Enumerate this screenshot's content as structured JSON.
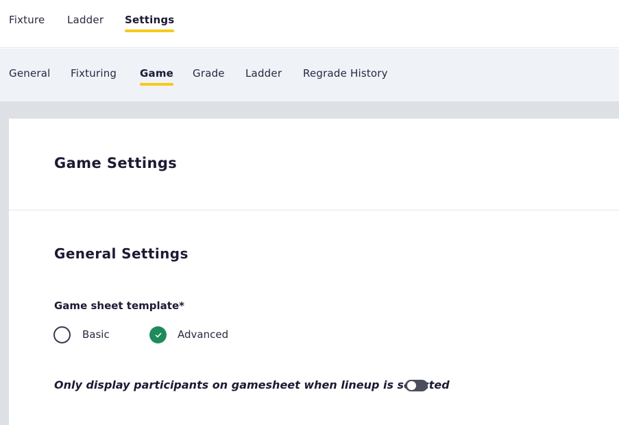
{
  "top_tabs": [
    {
      "label": "Fixture",
      "active": false
    },
    {
      "label": "Ladder",
      "active": false
    },
    {
      "label": "Settings",
      "active": true
    }
  ],
  "sub_tabs": [
    {
      "label": "General",
      "active": false
    },
    {
      "label": "Fixturing",
      "active": false
    },
    {
      "label": "Game",
      "active": true
    },
    {
      "label": "Grade",
      "active": false
    },
    {
      "label": "Ladder",
      "active": false
    },
    {
      "label": "Regrade History",
      "active": false
    }
  ],
  "page": {
    "title": "Game Settings",
    "section_title": "General Settings"
  },
  "game_sheet_template": {
    "label": "Game sheet template*",
    "options": [
      {
        "label": "Basic",
        "selected": false
      },
      {
        "label": "Advanced",
        "selected": true
      }
    ]
  },
  "lineup_toggle": {
    "label": "Only display participants on gamesheet when lineup is selected",
    "on": false
  },
  "colors": {
    "accent_underline": "#f7c91a",
    "radio_checked": "#1f8a5b",
    "toggle_off": "#4b4f5c"
  }
}
